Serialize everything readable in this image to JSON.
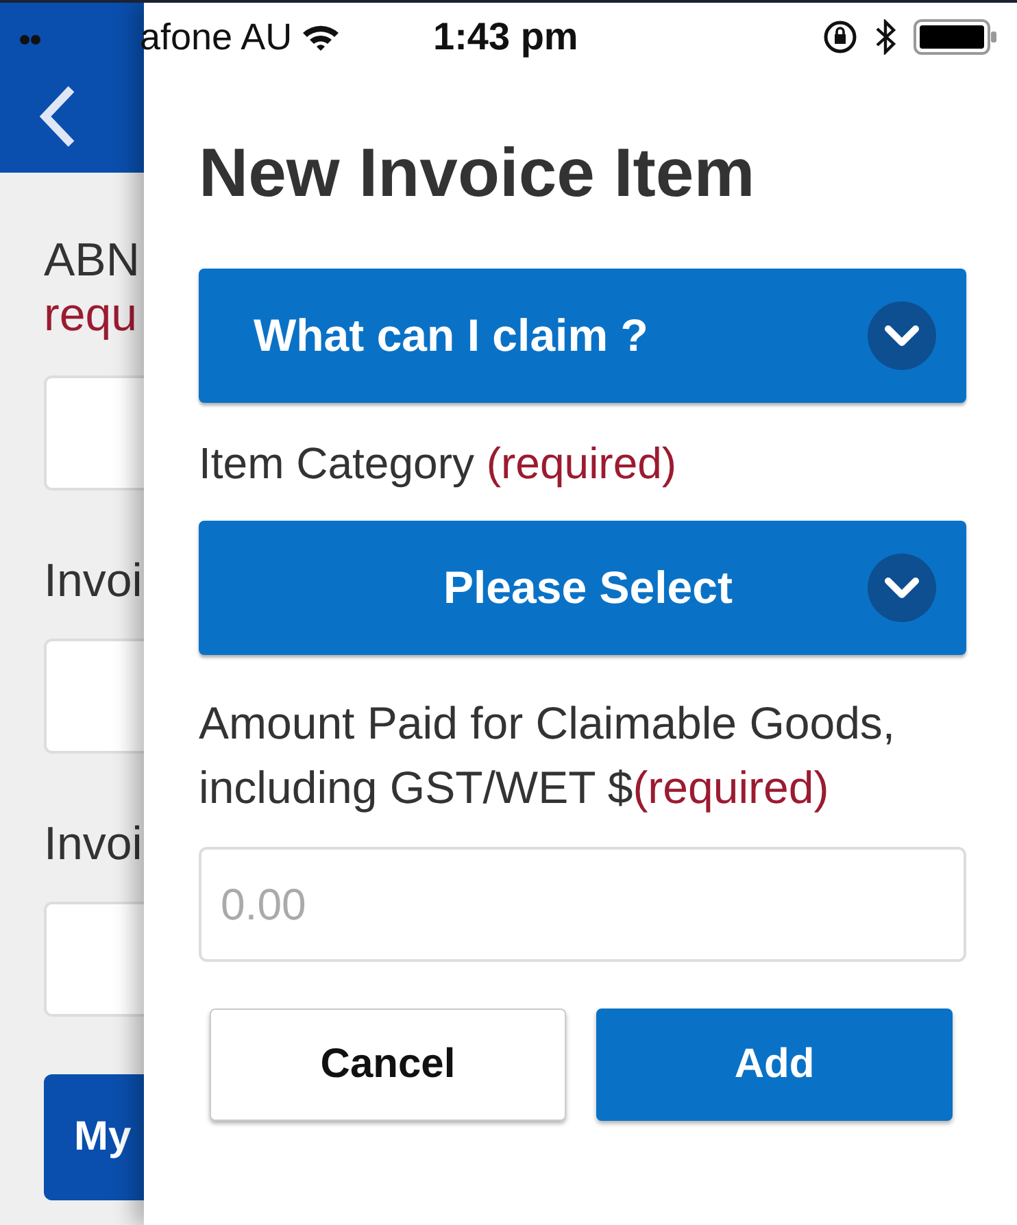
{
  "status_bar": {
    "carrier": "afone AU",
    "time": "1:43 pm"
  },
  "background_page": {
    "labels": [
      {
        "text": "ABN",
        "kind": "label"
      },
      {
        "text": "requ",
        "kind": "required"
      },
      {
        "kind": "field"
      },
      {
        "text": "Invoi",
        "kind": "label"
      },
      {
        "kind": "field"
      },
      {
        "text": "Invoi",
        "kind": "label"
      },
      {
        "kind": "field"
      }
    ],
    "button": "My"
  },
  "dialog": {
    "title": "New Invoice Item",
    "claim_dropdown": {
      "label": "What can I claim ?",
      "kind": "leading"
    },
    "category_label": "Item Category",
    "category_required": "(required)",
    "category_dropdown": {
      "label": "Please Select",
      "kind": "centered"
    },
    "amount_label": "Amount Paid for Claimable Goods, including GST/WET $",
    "amount_required": "(required)",
    "amount_field": {
      "placeholder": "0.00"
    },
    "buttons": [
      {
        "label": "Cancel",
        "kind": "secondary"
      },
      {
        "label": "Add",
        "kind": "primary"
      }
    ]
  }
}
